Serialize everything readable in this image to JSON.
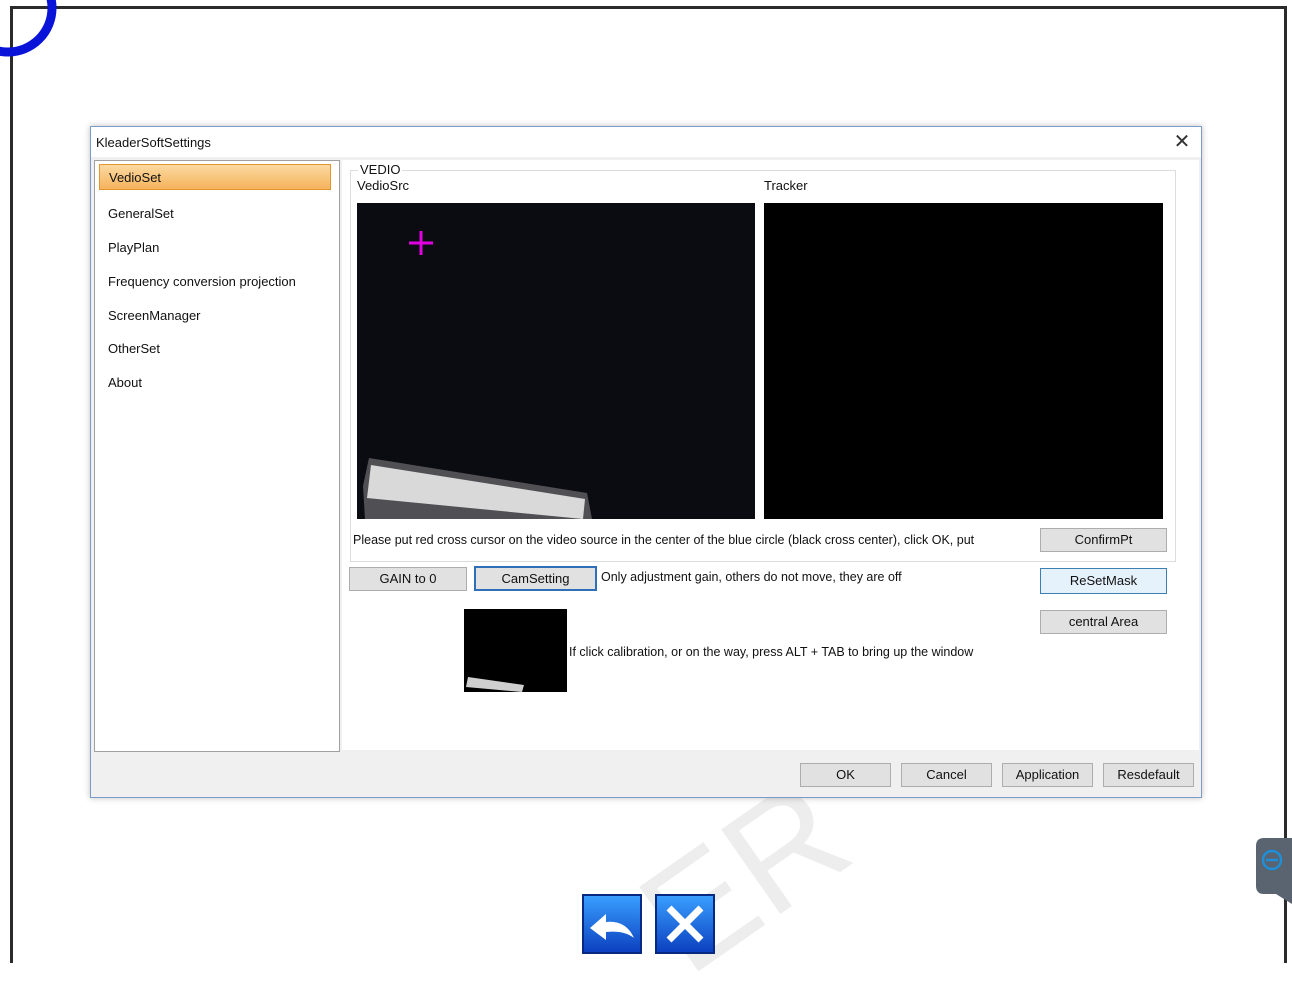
{
  "dialog": {
    "title": "KleaderSoftSettings"
  },
  "nav": {
    "items": [
      {
        "label": "VedioSet",
        "selected": true
      },
      {
        "label": "GeneralSet"
      },
      {
        "label": "PlayPlan"
      },
      {
        "label": "Frequency conversion projection"
      },
      {
        "label": "ScreenManager"
      },
      {
        "label": "OtherSet"
      },
      {
        "label": "About"
      }
    ]
  },
  "video": {
    "group_label": "VEDIO",
    "src_label": "VedioSrc",
    "tracker_label": "Tracker",
    "instruction": "Please put red cross cursor on the video source in the center of the blue circle (black cross center), click OK, put",
    "confirm_btn": "ConfirmPt",
    "gain_btn": "GAIN to 0",
    "cam_btn": "CamSetting",
    "gain_note": "Only adjustment gain, others do not move, they are off",
    "reset_mask_btn": "ReSetMask",
    "central_area_btn": "central Area",
    "calibration_note": "If click calibration, or on the way, press ALT + TAB to bring up the window"
  },
  "footer": {
    "ok": "OK",
    "cancel": "Cancel",
    "application": "Application",
    "resdefault": "Resdefault"
  },
  "overlay": {
    "watermark": "ER"
  },
  "colors": {
    "selected_bg": "#f6b35c",
    "crosshair": "#e000e0",
    "corner_arc": "#0a14d8",
    "focus_border": "#2f6fb7"
  }
}
